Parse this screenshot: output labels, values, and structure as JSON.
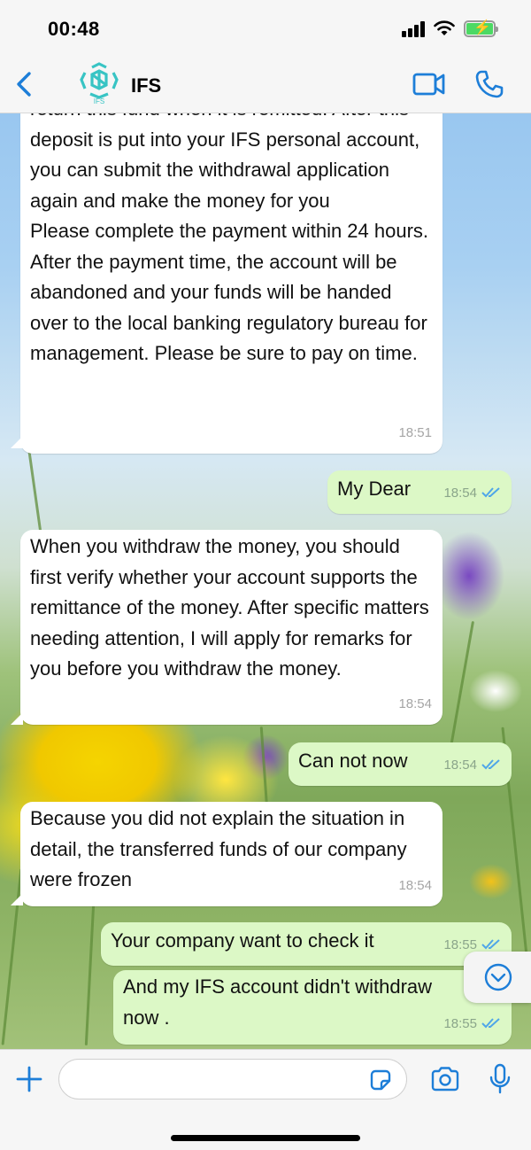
{
  "status_bar": {
    "time": "00:48"
  },
  "header": {
    "contact_name": "IFS",
    "avatar_text": "IFS",
    "accent_color": "#1d7ed8"
  },
  "messages": [
    {
      "direction": "incoming",
      "text": "return this fund when it is remitted. After this deposit is put into your IFS personal account, you can submit the withdrawal application again and make the money for you\nPlease complete the payment within 24 hours. After the payment time, the account will be abandoned and your funds will be handed over to the local banking regulatory bureau for management. Please be sure to pay on time.",
      "time": "18:51"
    },
    {
      "direction": "outgoing",
      "text": "My Dear",
      "time": "18:54",
      "status": "read"
    },
    {
      "direction": "incoming",
      "text": "When you withdraw the money, you should first verify whether your account supports the remittance of the money. After specific matters needing attention, I will apply for remarks for you before you withdraw the money.",
      "time": "18:54"
    },
    {
      "direction": "outgoing",
      "text": "Can not now",
      "time": "18:54",
      "status": "read"
    },
    {
      "direction": "incoming",
      "text": "Because you did not explain the situation in detail, the transferred funds of our company were frozen",
      "time": "18:54"
    },
    {
      "direction": "outgoing",
      "text": "Your company want to check it",
      "time": "18:55",
      "status": "read"
    },
    {
      "direction": "outgoing",
      "text": "And my IFS account didn't withdraw now .",
      "time": "18:55",
      "status": "read"
    }
  ],
  "input": {
    "value": "",
    "placeholder": ""
  },
  "colors": {
    "incoming_bubble": "#ffffff",
    "outgoing_bubble": "#dcf8c6",
    "read_ticks": "#4fa6e8"
  }
}
